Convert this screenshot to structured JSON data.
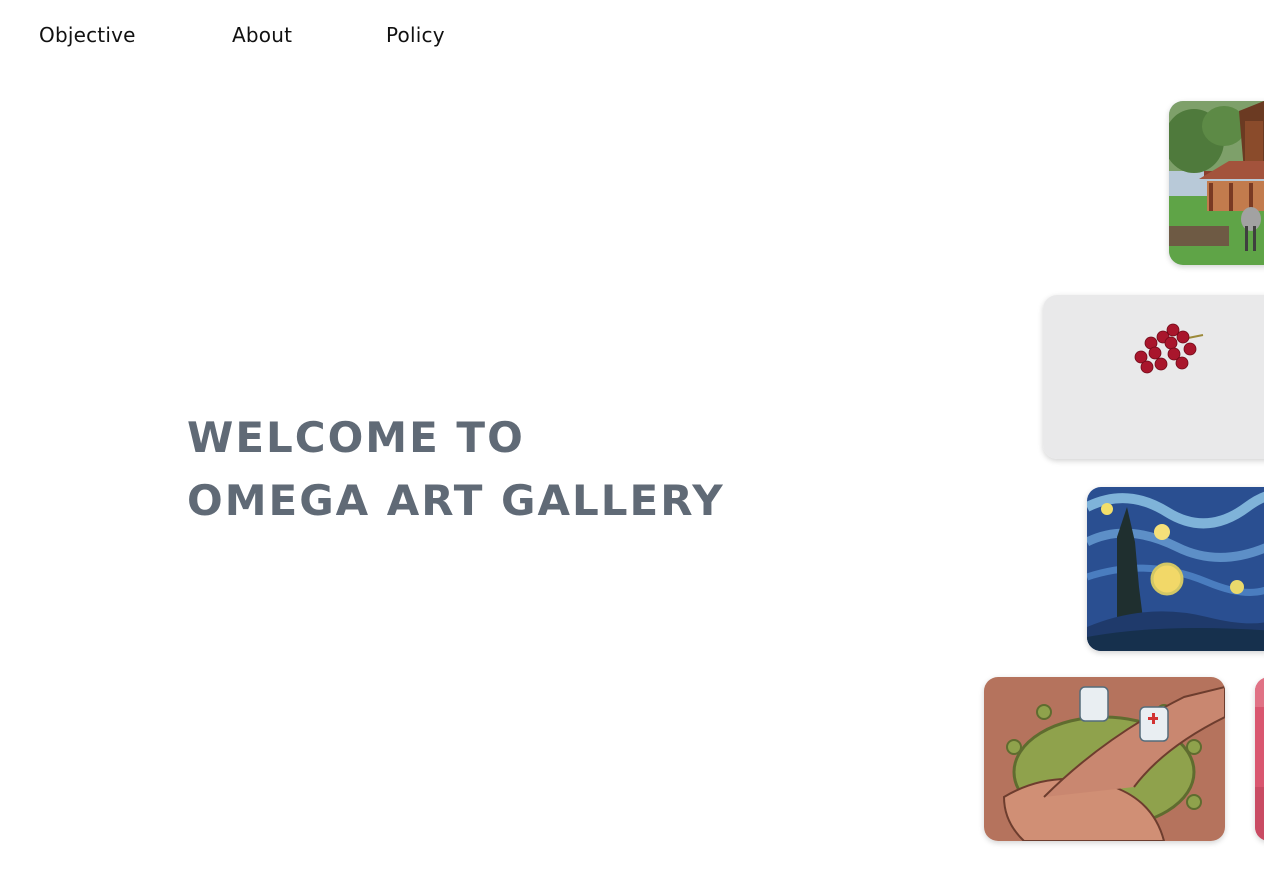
{
  "nav": {
    "items": [
      {
        "label": "Objective"
      },
      {
        "label": "About"
      },
      {
        "label": "Policy"
      }
    ]
  },
  "hero": {
    "line1": "WELCOME TO",
    "line2": "OMEGA ART GALLERY"
  },
  "gallery": {
    "cards": [
      {
        "subject": "traditional-village-house"
      },
      {
        "subject": "red-grapes"
      },
      {
        "subject": "starry-night-painting"
      },
      {
        "subject": "virus-hands-illustration"
      },
      {
        "subject": "pink-artwork"
      }
    ]
  },
  "colors": {
    "heading": "#606a76",
    "nav_text": "#111111",
    "background": "#ffffff"
  }
}
